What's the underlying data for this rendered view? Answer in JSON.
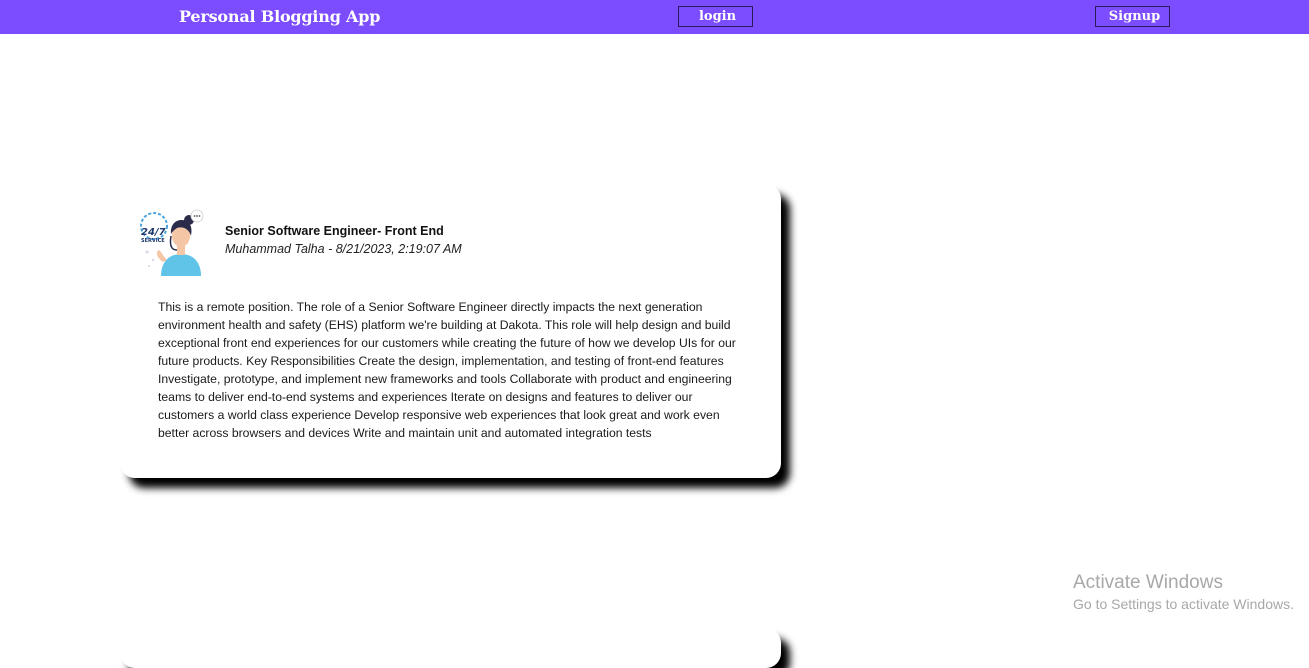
{
  "navbar": {
    "brand": "Personal Blogging App",
    "login_label": "login",
    "signup_label": "Signup",
    "background_color": "#7c4dff"
  },
  "posts": [
    {
      "avatar_icon": "customer-service-24-7-avatar",
      "avatar_badge_text": "24/7",
      "avatar_badge_sub": "SERVICE",
      "title": "Senior Software Engineer- Front End",
      "meta": "Muhammad Talha - 8/21/2023, 2:19:07 AM",
      "body": "This is a remote position. The role of a Senior Software Engineer directly impacts the next generation environment health and safety (EHS) platform we're building at Dakota. This role will help design and build exceptional front end experiences for our customers while creating the future of how we develop UIs for our future products. Key Responsibilities Create the design, implementation, and testing of front-end features Investigate, prototype, and implement new frameworks and tools Collaborate with product and engineering teams to deliver end-to-end systems and experiences Iterate on designs and features to deliver our customers a world class experience Develop responsive web experiences that look great and work even better across browsers and devices Write and maintain unit and automated integration tests"
    }
  ],
  "watermark": {
    "title": "Activate Windows",
    "subtitle": "Go to Settings to activate Windows."
  }
}
